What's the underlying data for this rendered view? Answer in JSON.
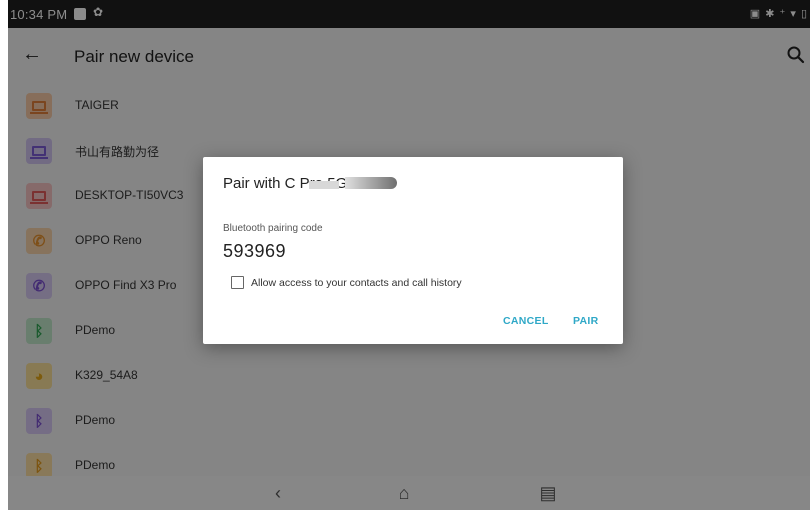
{
  "status_bar": {
    "time": "10:34 PM",
    "notif_icons": [
      "message-icon",
      "gear-icon"
    ],
    "system_icons": [
      "screenshot-icon",
      "bluetooth-icon",
      "wifi-icon",
      "battery-icon"
    ],
    "right_text": "▣ ✱ ⁺ ▾ ▯"
  },
  "app_bar": {
    "title": "Pair new device"
  },
  "devices": [
    {
      "name": "TAIGER",
      "icon": "laptop-icon",
      "icon_bg": "#f6c9a6",
      "icon_color": "#e07f3a"
    },
    {
      "name": "书山有路勤为径",
      "icon": "laptop-icon",
      "icon_bg": "#cfc4ee",
      "icon_color": "#7a59d6"
    },
    {
      "name": "DESKTOP-TI50VC3",
      "icon": "laptop-icon",
      "icon_bg": "#f5c2c2",
      "icon_color": "#e05a5a"
    },
    {
      "name": "OPPO Reno",
      "icon": "phone-icon",
      "icon_bg": "#f6d2aa",
      "icon_color": "#e6902c"
    },
    {
      "name": "OPPO Find X3 Pro",
      "icon": "phone-icon",
      "icon_bg": "#d6c8f0",
      "icon_color": "#7a4fd0"
    },
    {
      "name": "PDemo",
      "icon": "bluetooth-icon",
      "icon_bg": "#bfe6c8",
      "icon_color": "#2fa552"
    },
    {
      "name": "K329_54A8",
      "icon": "headset-icon",
      "icon_bg": "#f8de9a",
      "icon_color": "#e3a616"
    },
    {
      "name": "PDemo",
      "icon": "bluetooth-icon",
      "icon_bg": "#d5c7f2",
      "icon_color": "#7a4fd0"
    },
    {
      "name": "PDemo",
      "icon": "bluetooth-icon",
      "icon_bg": "#f9dca2",
      "icon_color": "#e29a1d"
    }
  ],
  "dialog": {
    "title": "Pair with C        Pro 5G?",
    "code_label": "Bluetooth pairing code",
    "code": "593969",
    "contacts_label": "Allow access to your contacts and call history",
    "contacts_checked": false,
    "cancel_label": "CANCEL",
    "pair_label": "PAIR",
    "accent": "#2fa8c7"
  },
  "nav": {
    "back_glyph": "‹",
    "home_glyph": "⌂",
    "recent_glyph": "▤"
  }
}
